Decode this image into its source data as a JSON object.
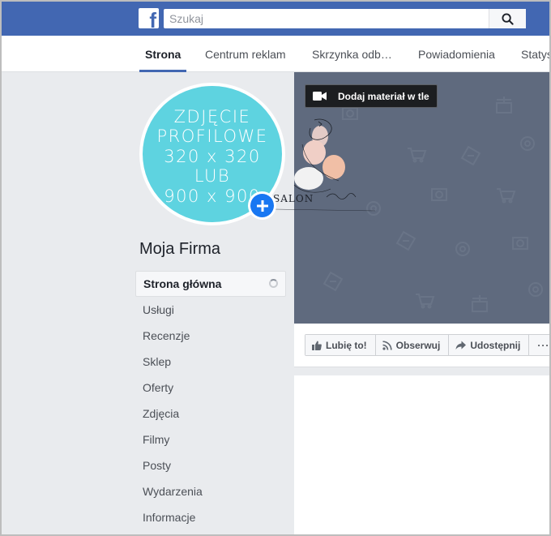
{
  "topbar": {
    "logo": "f",
    "search_placeholder": "Szukaj",
    "search_icon": "search-icon"
  },
  "page_nav": {
    "tabs": [
      {
        "label": "Strona",
        "active": true
      },
      {
        "label": "Centrum reklam"
      },
      {
        "label": "Skrzynka odb…"
      },
      {
        "label": "Powiadomienia"
      },
      {
        "label": "Statys"
      }
    ]
  },
  "profile": {
    "placeholder_text": "ZDJĘCIE\nPROFILOWE\n320 x 320\nLUB\n900 x 900",
    "page_name": "Moja Firma",
    "add_icon": "plus-icon"
  },
  "menu": {
    "items": [
      {
        "label": "Strona główna",
        "active": true
      },
      {
        "label": "Usługi"
      },
      {
        "label": "Recenzje"
      },
      {
        "label": "Sklep"
      },
      {
        "label": "Oferty"
      },
      {
        "label": "Zdjęcia"
      },
      {
        "label": "Filmy"
      },
      {
        "label": "Posty"
      },
      {
        "label": "Wydarzenia"
      },
      {
        "label": "Informacje"
      }
    ]
  },
  "cover": {
    "add_video_label": "Dodaj materiał w tle",
    "logo_text": "SALON",
    "colors": {
      "cover_bg": "#5f6a7e",
      "accent": "#4267b2"
    }
  },
  "actions": {
    "like": "Lubię to!",
    "follow": "Obserwuj",
    "share": "Udostępnij",
    "more": "···"
  }
}
